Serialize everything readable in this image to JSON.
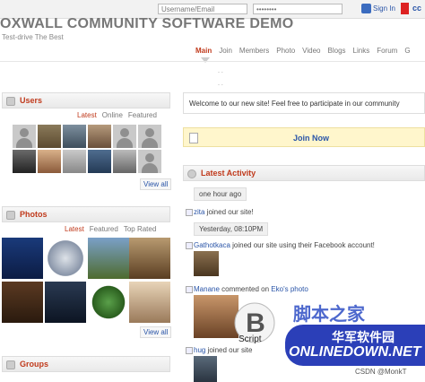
{
  "topbar": {
    "username_placeholder": "Username/Email",
    "password_value": "••••••••",
    "signin_label": "Sign In",
    "c_label": "cc"
  },
  "site": {
    "title": "OXWALL COMMUNITY SOFTWARE DEMO",
    "tagline": "Test-drive The Best"
  },
  "nav": {
    "items": [
      "Main",
      "Join",
      "Members",
      "Photo",
      "Video",
      "Blogs",
      "Links",
      "Forum",
      "G"
    ]
  },
  "users": {
    "title": "Users",
    "tabs": [
      "Latest",
      "Online",
      "Featured"
    ],
    "view_all": "View all"
  },
  "photos": {
    "title": "Photos",
    "tabs": [
      "Latest",
      "Featured",
      "Top Rated"
    ],
    "view_all": "View all"
  },
  "groups": {
    "title": "Groups"
  },
  "main": {
    "welcome": "Welcome to our new site! Feel free to participate in our community",
    "join_now": "Join Now",
    "latest_activity": "Latest Activity",
    "time1": "one hour ago",
    "act1_user": "zita",
    "act1_text": " joined our site!",
    "time2": "Yesterday, 08:10PM",
    "act2_user": "Gathotkaca",
    "act2_text": " joined our site using their Facebook account!",
    "act3_user": "Manane",
    "act3_text": " commented on ",
    "act3_target": "Eko's photo",
    "act4_user": "hug",
    "act4_text": " joined our site"
  },
  "watermark": {
    "jb_cn": "脚本之家",
    "script": "Script",
    "hj_cn": "华军软件园",
    "onlinedown": "ONLINEDOWN.NET",
    "csdn": "CSDN @MonkT"
  },
  "colors": {
    "accent": "#c03a1c",
    "link": "#2a55a8",
    "join_bg": "#fff6cc"
  }
}
